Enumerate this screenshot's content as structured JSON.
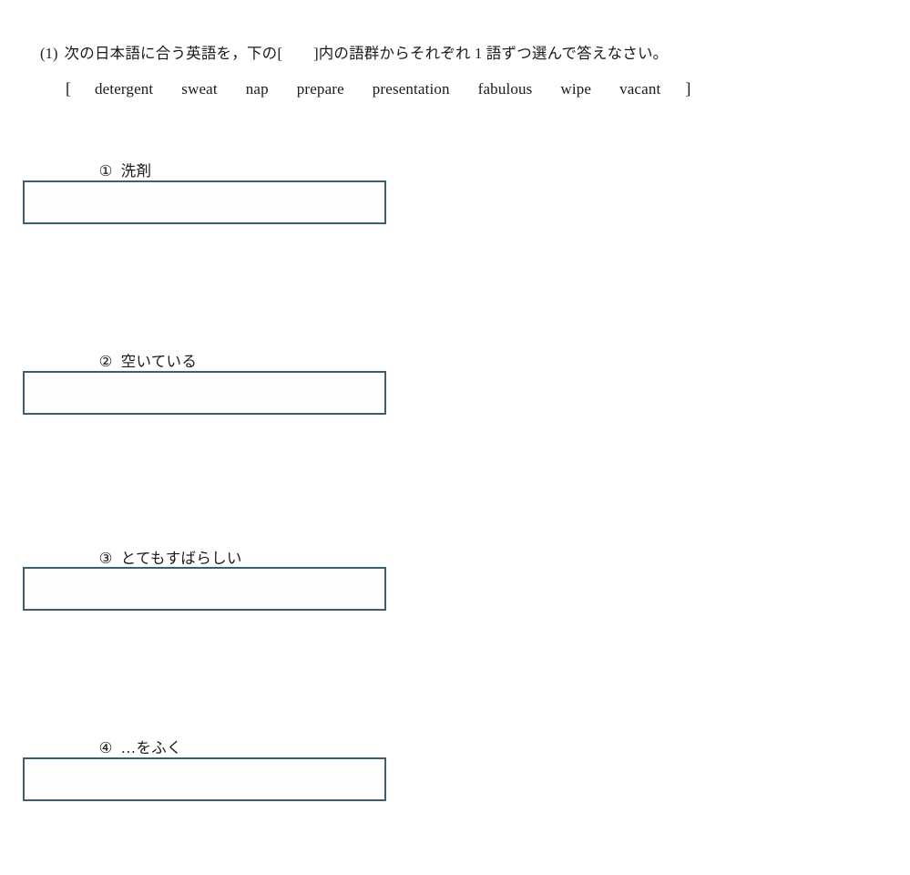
{
  "page": {
    "background_color": "#ffffff",
    "text_color": "#1a1a1a",
    "box_border_color": "#3c5f6f"
  },
  "prompt": {
    "number": "(1)",
    "text_before_bracket": "次の日本語に合う英語を，下の",
    "bracket_open": "[",
    "bracket_close": "]",
    "text_after_bracket": "内の語群からそれぞれ 1 語ずつ選んで答えなさい。"
  },
  "wordbank": {
    "bracket_open": "[",
    "bracket_close": "]",
    "words": [
      "detergent",
      "sweat",
      "nap",
      "prepare",
      "presentation",
      "fabulous",
      "wipe",
      "vacant"
    ]
  },
  "items": [
    {
      "marker": "①",
      "label": "洗剤",
      "answer": "",
      "answer_placeholder": ""
    },
    {
      "marker": "②",
      "label": "空いている",
      "answer": "",
      "answer_placeholder": ""
    },
    {
      "marker": "③",
      "label": "とてもすばらしい",
      "answer": "",
      "answer_placeholder": ""
    },
    {
      "marker": "④",
      "label": "…をふく",
      "answer": "",
      "answer_placeholder": ""
    }
  ]
}
